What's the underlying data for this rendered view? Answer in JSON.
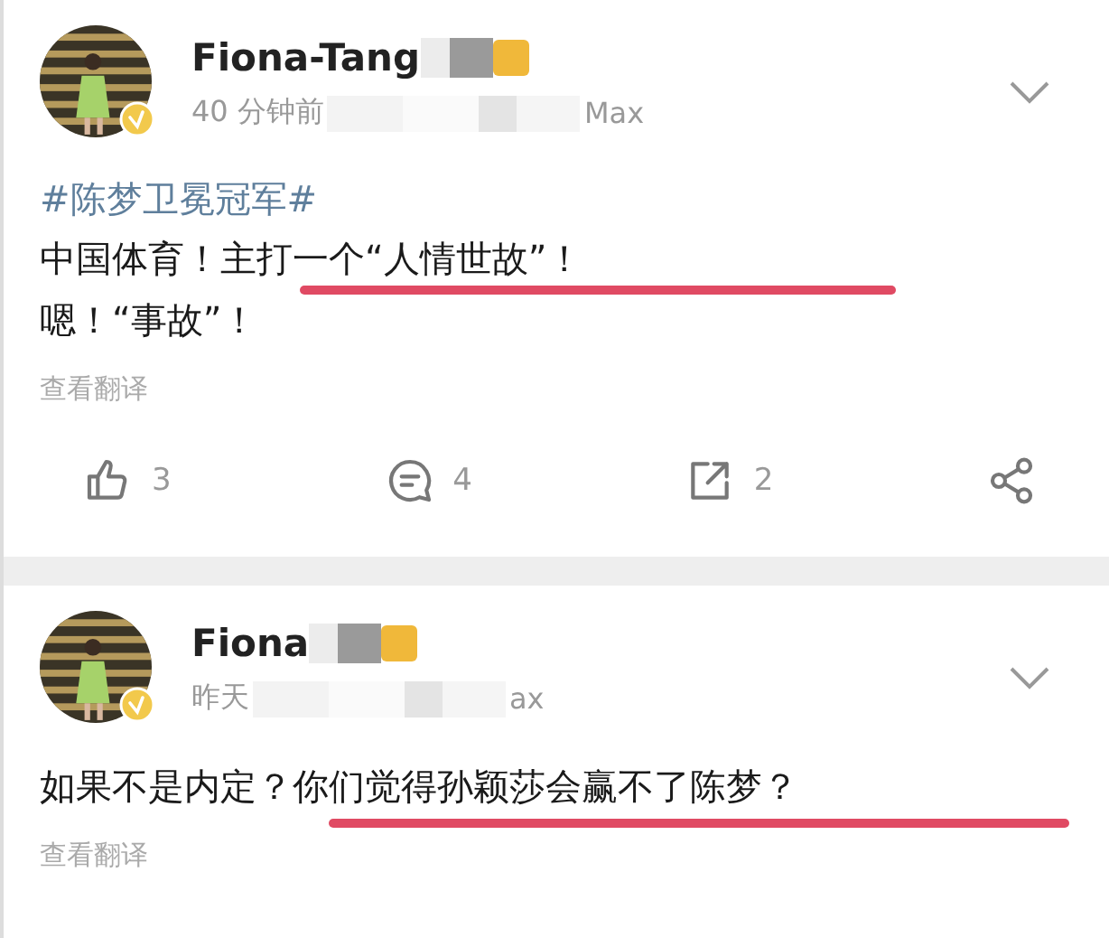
{
  "posts": [
    {
      "author": "Fiona-Tang",
      "author_badge": true,
      "time": "40 分钟前",
      "device": "Max",
      "verified": true,
      "hashtag": "#陈梦卫冕冠军#",
      "lines": [
        {
          "text": "中国体育！主打一个“人情世故”！",
          "underlined": true
        },
        {
          "text": "嗯！“事故”！",
          "underlined": false
        }
      ],
      "translate": "查看翻译",
      "actions": [
        {
          "kind": "like",
          "count": "3"
        },
        {
          "kind": "comment",
          "count": "4"
        },
        {
          "kind": "repost",
          "count": "2"
        },
        {
          "kind": "share"
        }
      ]
    },
    {
      "author": "Fiona",
      "author_badge": true,
      "time": "昨天",
      "device": "ax",
      "verified": true,
      "lines": [
        {
          "text": "如果不是内定？你们觉得孙颖莎会赢不了陈梦？",
          "underlined": true
        }
      ],
      "translate": "查看翻译"
    }
  ]
}
